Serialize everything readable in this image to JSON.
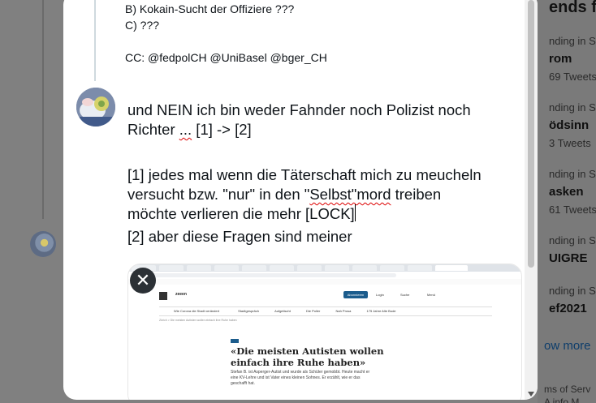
{
  "previous_tweet": {
    "lines": [
      "B) Kokain-Sucht der Offiziere ???",
      "C) ???",
      "",
      "CC: @fedpolCH @UniBasel @bger_CH"
    ]
  },
  "reply": {
    "line1": "und NEIN ich bin weder Fahnder noch Polizist noch",
    "line2_start": "Richter ",
    "line2_ellipsis": "...",
    "line2_end": " [1] -> [2]",
    "line3": "[1] jedes mal wenn die Täterschaft mich zu meucheln",
    "line4_start": "versucht bzw. \"nur\" in den \"",
    "line4_spell": "Selbst\"mord",
    "line4_end": " treiben",
    "line5": "möchte verlieren die mehr [LOCK]",
    "line6": "[2] aber diese Fragen sind meiner"
  },
  "media": {
    "site_brand": "zeeen",
    "subscribe_button": "Abonnieren",
    "login_link": "Login",
    "search_link": "Suche",
    "menu_link": "Menü",
    "nav_items": [
      "Wie Corona die Stadt verändert",
      "Stadtgespräch",
      "Aufgetischt",
      "Die Poller",
      "Nah Prosa",
      "175 Jahre Alte Bude"
    ],
    "breadcrumb": "Zürich > Die meisten Autisten wollen einfach ihre Ruhe haben",
    "headline": "«Die meisten Autisten wollen einfach ihre Ruhe haben»",
    "lead": "Stefan B. ist Asperger-Autist und wurde als Schüler gemobbt. Heute macht er eine KV-Lehre und ist Vater eines kleinen Sohnes. Er erzählt, wie er das geschafft hat."
  },
  "remove_media_icon": "close-icon",
  "trends_panel": {
    "title": "ends f",
    "items": [
      {
        "meta": "nding in S",
        "name": "rom",
        "count": "69 Tweets"
      },
      {
        "meta": "nding in S",
        "name": "ödsinn",
        "count": "3 Tweets"
      },
      {
        "meta": "nding in S",
        "name": "asken",
        "count": "61 Tweets"
      },
      {
        "meta": "nding in S",
        "name": "UIGRE",
        "count": ""
      },
      {
        "meta": "nding in S",
        "name": "ef2021",
        "count": ""
      }
    ],
    "show_more": "ow more",
    "footer_line1": "ms of Serv",
    "footer_line2": "A info M"
  }
}
